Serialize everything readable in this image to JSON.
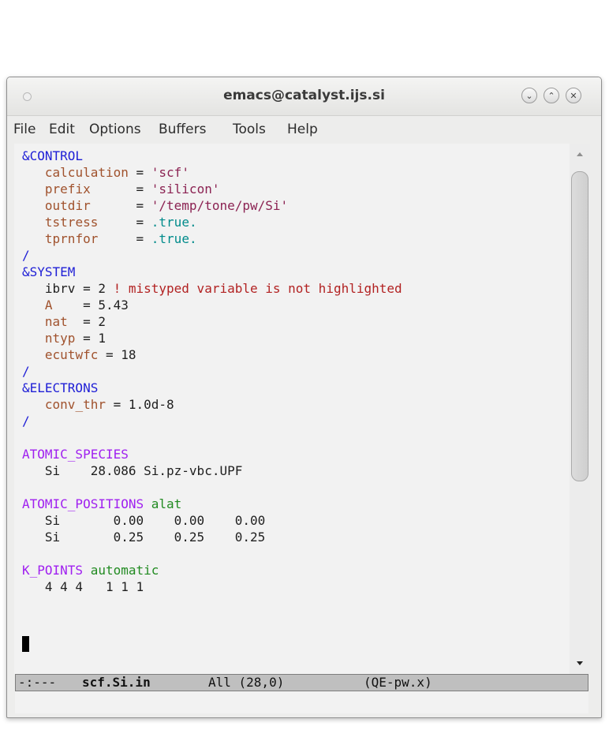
{
  "window": {
    "title": "emacs@catalyst.ijs.si",
    "controls": {
      "minimize": "⌄",
      "maximize": "⌃",
      "close": "✕"
    }
  },
  "menu": [
    "File",
    "Edit",
    "Options",
    "Buffers",
    "Tools",
    "Help"
  ],
  "buffer": {
    "lines": [
      [
        {
          "t": "&CONTROL",
          "c": "kw"
        }
      ],
      [
        {
          "t": "   "
        },
        {
          "t": "calculation",
          "c": "var"
        },
        {
          "t": " = ",
          "c": "plain"
        },
        {
          "t": "'scf'",
          "c": "str"
        }
      ],
      [
        {
          "t": "   "
        },
        {
          "t": "prefix",
          "c": "var"
        },
        {
          "t": "      = ",
          "c": "plain"
        },
        {
          "t": "'silicon'",
          "c": "str"
        }
      ],
      [
        {
          "t": "   "
        },
        {
          "t": "outdir",
          "c": "var"
        },
        {
          "t": "      = ",
          "c": "plain"
        },
        {
          "t": "'/temp/tone/pw/Si'",
          "c": "str"
        }
      ],
      [
        {
          "t": "   "
        },
        {
          "t": "tstress",
          "c": "var"
        },
        {
          "t": "     = ",
          "c": "plain"
        },
        {
          "t": ".true.",
          "c": "const"
        }
      ],
      [
        {
          "t": "   "
        },
        {
          "t": "tprnfor",
          "c": "var"
        },
        {
          "t": "     = ",
          "c": "plain"
        },
        {
          "t": ".true.",
          "c": "const"
        }
      ],
      [
        {
          "t": "/",
          "c": "kw"
        }
      ],
      [
        {
          "t": "&SYSTEM",
          "c": "kw"
        }
      ],
      [
        {
          "t": "   ibrv = 2 ",
          "c": "plain"
        },
        {
          "t": "! mistyped variable is not highlighted",
          "c": "com"
        }
      ],
      [
        {
          "t": "   "
        },
        {
          "t": "A",
          "c": "var"
        },
        {
          "t": "    = 5.43",
          "c": "plain"
        }
      ],
      [
        {
          "t": "   "
        },
        {
          "t": "nat",
          "c": "var"
        },
        {
          "t": "  = 2",
          "c": "plain"
        }
      ],
      [
        {
          "t": "   "
        },
        {
          "t": "ntyp",
          "c": "var"
        },
        {
          "t": " = 1",
          "c": "plain"
        }
      ],
      [
        {
          "t": "   "
        },
        {
          "t": "ecutwfc",
          "c": "var"
        },
        {
          "t": " = 18",
          "c": "plain"
        }
      ],
      [
        {
          "t": "/",
          "c": "kw"
        }
      ],
      [
        {
          "t": "&ELECTRONS",
          "c": "kw"
        }
      ],
      [
        {
          "t": "   "
        },
        {
          "t": "conv_thr",
          "c": "var"
        },
        {
          "t": " = 1.0d-8",
          "c": "plain"
        }
      ],
      [
        {
          "t": "/",
          "c": "kw"
        }
      ],
      [],
      [
        {
          "t": "ATOMIC_SPECIES",
          "c": "card"
        }
      ],
      [
        {
          "t": "   Si    28.086 Si.pz-vbc.UPF",
          "c": "plain"
        }
      ],
      [],
      [
        {
          "t": "ATOMIC_POSITIONS",
          "c": "card"
        },
        {
          "t": " alat",
          "c": "opt"
        }
      ],
      [
        {
          "t": "   Si       0.00    0.00    0.00",
          "c": "plain"
        }
      ],
      [
        {
          "t": "   Si       0.25    0.25    0.25",
          "c": "plain"
        }
      ],
      [],
      [
        {
          "t": "K_POINTS",
          "c": "card"
        },
        {
          "t": " automatic",
          "c": "opt"
        }
      ],
      [
        {
          "t": "   4 4 4   1 1 1",
          "c": "plain"
        }
      ]
    ]
  },
  "modeline": {
    "status": "-:---",
    "buffer_name": "scf.Si.in",
    "position": "All (28,0)",
    "mode": "(QE-pw.x)"
  }
}
